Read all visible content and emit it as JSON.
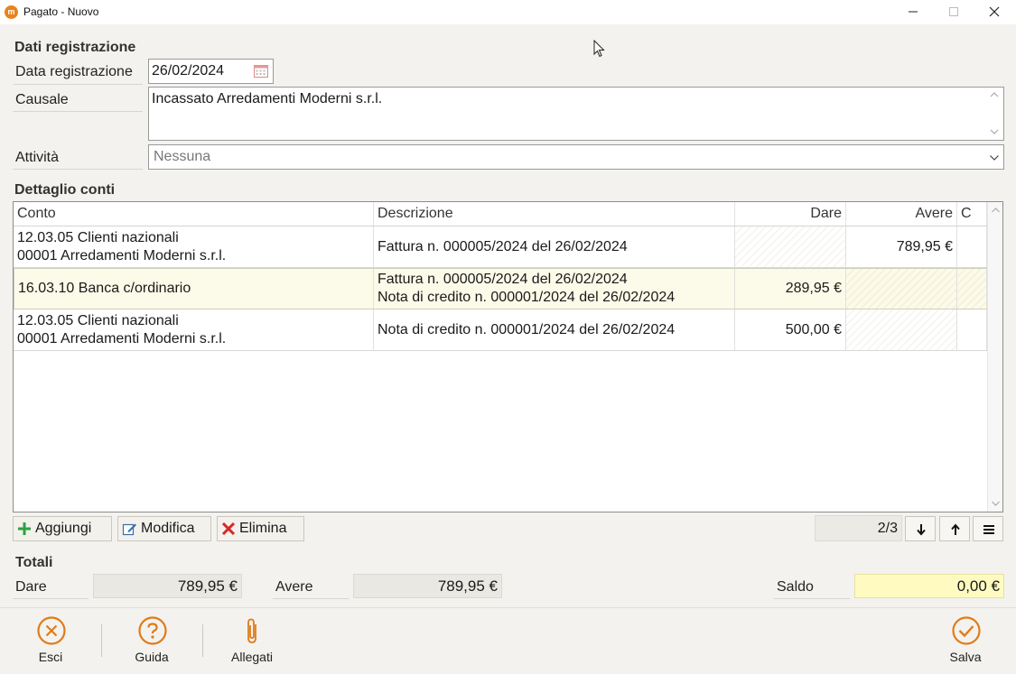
{
  "window": {
    "title": "Pagato - Nuovo",
    "app_icon": "m"
  },
  "registration": {
    "section_title": "Dati registrazione",
    "date_label": "Data registrazione",
    "date_value": "26/02/2024",
    "causale_label": "Causale",
    "causale_value": "Incassato Arredamenti Moderni s.r.l.",
    "activity_label": "Attività",
    "activity_value": "Nessuna"
  },
  "accounts": {
    "section_title": "Dettaglio conti",
    "columns": {
      "conto": "Conto",
      "descrizione": "Descrizione",
      "dare": "Dare",
      "avere": "Avere",
      "c": "C"
    },
    "rows": [
      {
        "conto_line1": "12.03.05 Clienti nazionali",
        "conto_line2": "00001 Arredamenti Moderni s.r.l.",
        "desc_line1": "Fattura n. 000005/2024 del 26/02/2024",
        "desc_line2": "",
        "dare": "",
        "avere": "789,95 €"
      },
      {
        "conto_line1": "16.03.10 Banca c/ordinario",
        "conto_line2": "",
        "desc_line1": "Fattura n. 000005/2024 del 26/02/2024",
        "desc_line2": "Nota di credito n. 000001/2024 del 26/02/2024",
        "dare": "289,95 €",
        "avere": ""
      },
      {
        "conto_line1": "12.03.05 Clienti nazionali",
        "conto_line2": "00001 Arredamenti Moderni s.r.l.",
        "desc_line1": "Nota di credito n. 000001/2024 del 26/02/2024",
        "desc_line2": "",
        "dare": "500,00 €",
        "avere": ""
      }
    ],
    "selected_row": 2
  },
  "toolbar": {
    "add": "Aggiungi",
    "edit": "Modifica",
    "delete": "Elimina",
    "pager": "2/3"
  },
  "totals": {
    "section_title": "Totali",
    "dare_label": "Dare",
    "dare_value": "789,95 €",
    "avere_label": "Avere",
    "avere_value": "789,95 €",
    "saldo_label": "Saldo",
    "saldo_value": "0,00 €"
  },
  "footer": {
    "exit": "Esci",
    "help": "Guida",
    "attachments": "Allegati",
    "save": "Salva"
  },
  "colors": {
    "accent": "#e07b1a",
    "selected_row": "#fcfae8",
    "saldo_bg": "#fffbc0",
    "add_green": "#2ea043",
    "delete_red": "#d62828"
  }
}
